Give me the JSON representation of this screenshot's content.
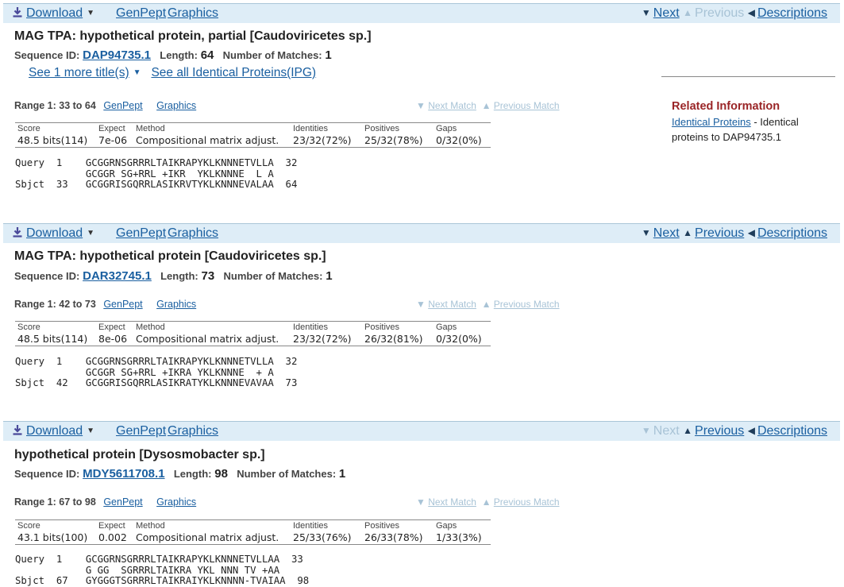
{
  "common": {
    "download": "Download",
    "genpept": "GenPept",
    "graphics": "Graphics",
    "next": "Next",
    "previous": "Previous",
    "descriptions": "Descriptions",
    "next_match": "Next Match",
    "previous_match": "Previous Match",
    "seq_id_label": "Sequence ID:",
    "length_label": "Length:",
    "matches_label": "Number of Matches:",
    "hdr_score": "Score",
    "hdr_expect": "Expect",
    "hdr_method": "Method",
    "hdr_identities": "Identities",
    "hdr_positives": "Positives",
    "hdr_gaps": "Gaps"
  },
  "hits": [
    {
      "title": "MAG TPA: hypothetical protein, partial [Caudoviricetes sp.]",
      "seq_id": "DAP94735.1",
      "length": "64",
      "matches": "1",
      "more_titles": "See 1 more title(s)",
      "identical": "See all Identical Proteins(IPG)",
      "range": "Range 1: 33 to 64",
      "score": "48.5 bits(114)",
      "expect": "7e-06",
      "method": "Compositional matrix adjust.",
      "identities": "23/32(72%)",
      "positives": "25/32(78%)",
      "gaps": "0/32(0%)",
      "alignment": "Query  1    GCGGRNSGRRRLTAIKRAPYKLKNNNETVLLA  32\n            GCGGR SG+RRL +IKR  YKLKNNNE  L A\nSbjct  33   GCGGRISGQRRLASIKRVTYKLKNNNEVALAA  64",
      "next_disabled": false,
      "prev_disabled": true
    },
    {
      "title": "MAG TPA: hypothetical protein [Caudoviricetes sp.]",
      "seq_id": "DAR32745.1",
      "length": "73",
      "matches": "1",
      "range": "Range 1: 42 to 73",
      "score": "48.5 bits(114)",
      "expect": "8e-06",
      "method": "Compositional matrix adjust.",
      "identities": "23/32(72%)",
      "positives": "26/32(81%)",
      "gaps": "0/32(0%)",
      "alignment": "Query  1    GCGGRNSGRRRLTAIKRAPYKLKNNNETVLLA  32\n            GCGGR SG+RRL +IKRA YKLKNNNE  + A\nSbjct  42   GCGGRISGQRRLASIKRATYKLKNNNEVAVAA  73",
      "next_disabled": false,
      "prev_disabled": false
    },
    {
      "title": "hypothetical protein [Dysosmobacter sp.]",
      "seq_id": "MDY5611708.1",
      "length": "98",
      "matches": "1",
      "range": "Range 1: 67 to 98",
      "score": "43.1 bits(100)",
      "expect": "0.002",
      "method": "Compositional matrix adjust.",
      "identities": "25/33(76%)",
      "positives": "26/33(78%)",
      "gaps": "1/33(3%)",
      "alignment": "Query  1    GCGGRNSGRRRLTAIKRAPYKLKNNNETVLLAA  33\n            G GG  SGRRRLTAIKRA YKL NNN TV +AA\nSbjct  67   GYGGGTSGRRRLTAIKRAIYKLKNNNN-TVAIAA  98",
      "next_disabled": true,
      "prev_disabled": false
    }
  ],
  "related": {
    "heading": "Related Information",
    "link": "Identical Proteins",
    "desc": "- Identical proteins to DAP94735.1"
  }
}
